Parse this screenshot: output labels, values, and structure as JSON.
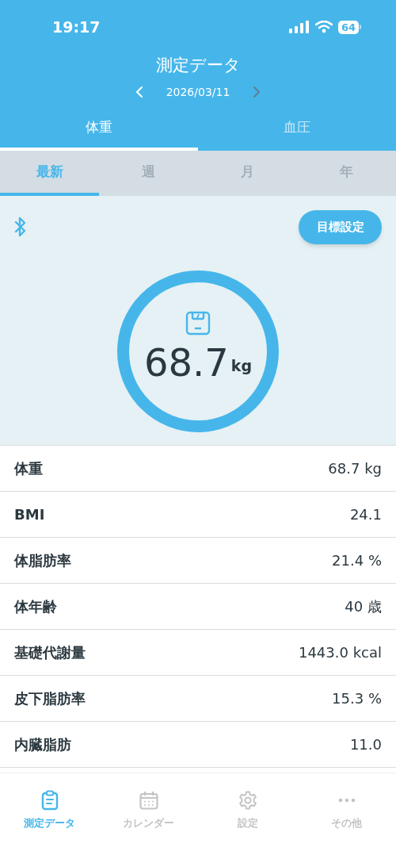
{
  "status_bar": {
    "time": "19:17",
    "battery": "64"
  },
  "header": {
    "title": "測定データ",
    "date": "2026/03/11",
    "prev": {
      "disabled": false
    },
    "next": {
      "disabled": true
    }
  },
  "tabs": [
    {
      "label": "体重",
      "selected": true
    },
    {
      "label": "血圧",
      "selected": false
    }
  ],
  "period_tabs": [
    {
      "label": "最新",
      "selected": true
    },
    {
      "label": "週",
      "selected": false
    },
    {
      "label": "月",
      "selected": false
    },
    {
      "label": "年",
      "selected": false
    }
  ],
  "panel": {
    "goal_button": "目標設定",
    "value": "68.7",
    "unit": "kg"
  },
  "rows": [
    {
      "label": "体重",
      "value": "68.7 kg"
    },
    {
      "label": "BMI",
      "value": "24.1"
    },
    {
      "label": "体脂肪率",
      "value": "21.4 %"
    },
    {
      "label": "体年齢",
      "value": "40 歳"
    },
    {
      "label": "基礎代謝量",
      "value": "1443.0 kcal"
    },
    {
      "label": "皮下脂肪率",
      "value": "15.3 %"
    },
    {
      "label": "内臓脂肪",
      "value": "11.0"
    }
  ],
  "bottom_nav": [
    {
      "kind": "clipboard",
      "label": "測定データ",
      "selected": true
    },
    {
      "kind": "calendar",
      "label": "カレンダー",
      "selected": false
    },
    {
      "kind": "gear",
      "label": "設定",
      "selected": false
    },
    {
      "kind": "dots",
      "label": "その他",
      "selected": false
    }
  ]
}
